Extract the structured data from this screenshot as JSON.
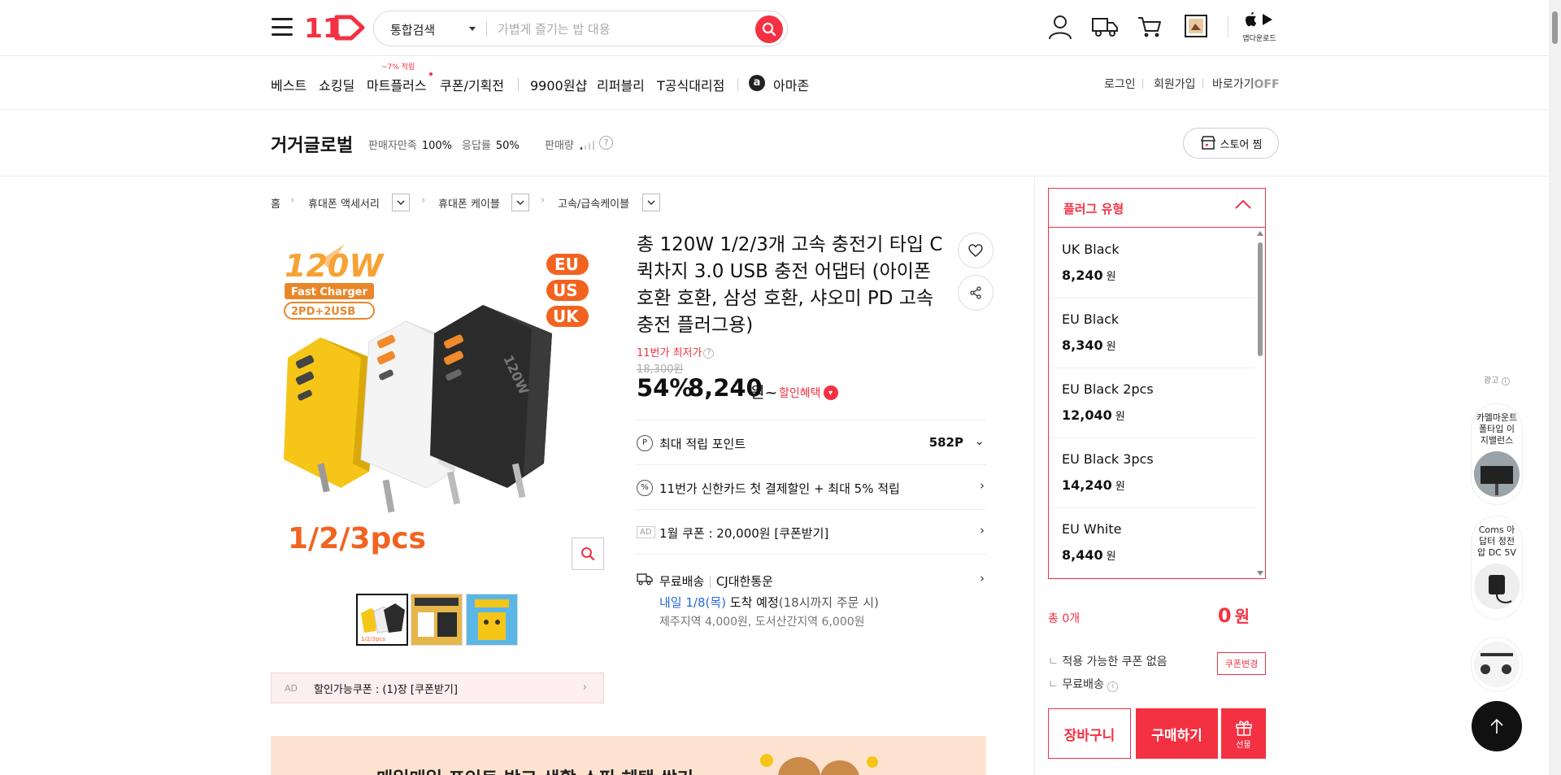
{
  "header": {
    "logo_text": "11",
    "search": {
      "category": "통합검색",
      "placeholder": "가볍게 즐기는 밥 대용"
    },
    "app_download": "앱다운로드"
  },
  "nav": {
    "items": [
      "베스트",
      "쇼킹딜",
      "마트플러스",
      "쿠폰/기획전",
      "9900원샵",
      "리퍼블리",
      "T공식대리점",
      "아마존"
    ],
    "mart_badge": "~7% 적립",
    "amazon_icon": "a",
    "util": [
      "로그인",
      "회원가입",
      "바로가기"
    ],
    "shortcut_state": "OFF"
  },
  "seller": {
    "name": "거거글로벌",
    "satisfaction_label": "판매자만족",
    "satisfaction": "100%",
    "response_label": "응답률",
    "response": "50%",
    "volume_label": "판매량",
    "store_button": "스토어 찜"
  },
  "breadcrumb": [
    "홈",
    "휴대폰 액세서리",
    "휴대폰 케이블",
    "고속/급속케이블"
  ],
  "image": {
    "watt": "120W",
    "fast_charger": "Fast Charger",
    "ports": "2PD+2USB",
    "regions": [
      "EU",
      "US",
      "UK"
    ],
    "pcs": "1/2/3pcs"
  },
  "product": {
    "title": "총 120W 1/2/3개 고속 충전기 타입 C 퀵차지 3.0 USB 충전 어댑터 (아이폰 호환 호환, 삼성 호환, 샤오미 PD 고속 충전 플러그용)",
    "lowest_label": "11번가 최저가",
    "original_price": "18,300원",
    "discount": "54%",
    "price": "8,240",
    "price_unit": "원~",
    "benefit_label": "할인혜택",
    "points_label": "최대 적립 포인트",
    "points_value": "582P",
    "card_label": "11번가 신한카드 첫 결제할인 + 최대 5% 적립",
    "coupon_ad": "1월 쿠폰 : 20,000원 [쿠폰받기]",
    "shipping_label": "무료배송",
    "shipping_carrier": "CJ대한통운",
    "arrival_date": "내일 1/8(목)",
    "arrival_text": "도착 예정",
    "arrival_note": "(18시까지 주문 시)",
    "extra_fee": "제주지역 4,000원, 도서산간지역 6,000원",
    "coupon_bar_text": "할인가능쿠폰 : (1)장 [쿠폰받기]",
    "ad_tag": "AD",
    "banner_text": "매일매일 포인트 받고 생활 소핑 혜택 쌓기"
  },
  "options": {
    "title": "플러그 유형",
    "items": [
      {
        "name": "UK Black",
        "price": "8,240"
      },
      {
        "name": "EU Black",
        "price": "8,340"
      },
      {
        "name": "EU Black 2pcs",
        "price": "12,040"
      },
      {
        "name": "EU Black 3pcs",
        "price": "14,240"
      },
      {
        "name": "EU White",
        "price": "8,440"
      }
    ],
    "unit": "원"
  },
  "order": {
    "total_label": "총 0개",
    "total_value": "0",
    "total_unit": "원",
    "coupon_none": "적용 가능한 쿠폰 없음",
    "coupon_change": "쿠폰변경",
    "free_shipping": "무료배송",
    "cart": "장바구니",
    "buy": "구매하기",
    "gift": "선물"
  },
  "side": {
    "ad_label": "광고",
    "ads": [
      "카멜마운트 폴타입 이지밸런스",
      "Coms 아답터 정전압 DC 5V"
    ]
  },
  "colors": {
    "accent": "#f43142",
    "text": "#111111",
    "muted": "#999999"
  }
}
